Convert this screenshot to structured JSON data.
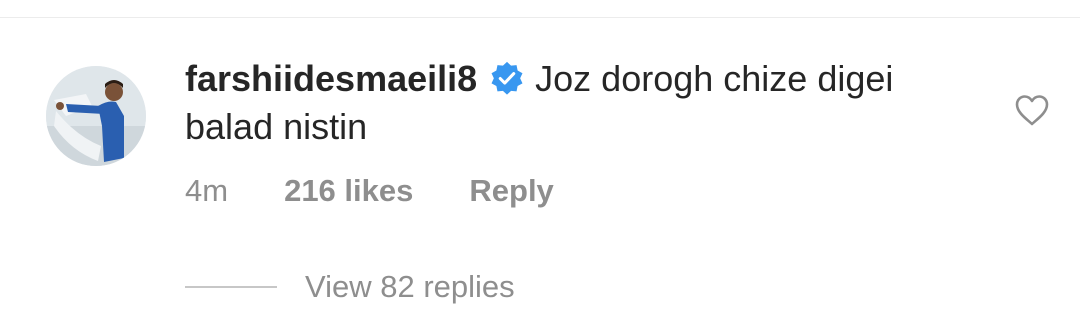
{
  "comment": {
    "username": "farshiidesmaeili8",
    "verified": true,
    "verified_icon": "verified-badge-icon",
    "text": "Joz dorogh chize digei balad nistin",
    "time": "4m",
    "likes": "216 likes",
    "reply_label": "Reply",
    "like_icon": "heart-outline-icon",
    "view_replies_label": "View 82 replies"
  },
  "colors": {
    "text_primary": "#262626",
    "text_secondary": "#8e8e8e",
    "verified_blue": "#3897f0",
    "divider": "#c7c7c7"
  }
}
